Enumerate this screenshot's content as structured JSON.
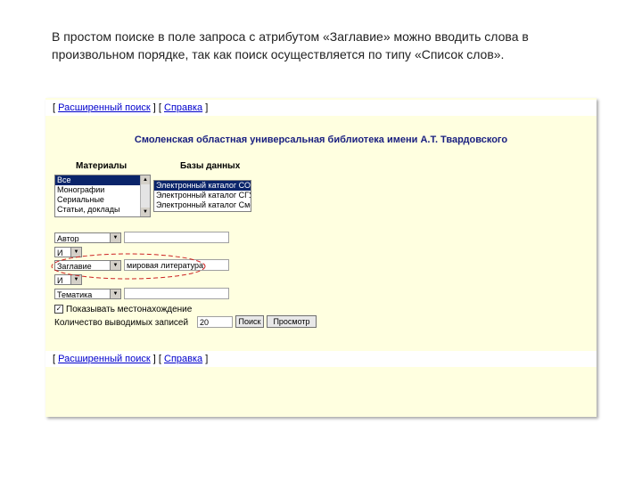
{
  "caption": "В простом поиске в поле запроса с атрибутом «Заглавие» можно вводить слова в произвольном порядке, так как поиск осуществляется по типу «Список слов».",
  "links": {
    "extended_search": "Расширенный поиск",
    "help": "Справка",
    "open_bracket": "[ ",
    "separator": " ] [ ",
    "close_bracket": " ]"
  },
  "library_title": "Смоленская областная универсальная библиотека имени А.Т. Твардовского",
  "materials": {
    "label": "Материалы",
    "options": [
      "Все",
      "Монографии",
      "Сериальные",
      "Статьи, доклады"
    ]
  },
  "databases": {
    "label": "Базы данных",
    "options": [
      "Электронный каталог СОУБ",
      "Электронный каталог СГУ",
      "Электронный каталог СмолГУ"
    ]
  },
  "search_rows": [
    {
      "field": "Автор",
      "value": ""
    },
    {
      "field": "Заглавие",
      "value": "мировая литература"
    },
    {
      "field": "Тематика",
      "value": ""
    }
  ],
  "operators": [
    "И",
    "И"
  ],
  "show_location_label": "Показывать местонахождение",
  "quantity_label": "Количество выводимых записей",
  "quantity_value": "20",
  "buttons": {
    "search": "Поиск",
    "browse": "Просмотр"
  },
  "colors": {
    "panel_bg": "#ffffe0",
    "link": "#0000cc",
    "title": "#1a2080",
    "selected": "#0a246a",
    "highlight_ellipse": "#cc2222"
  }
}
